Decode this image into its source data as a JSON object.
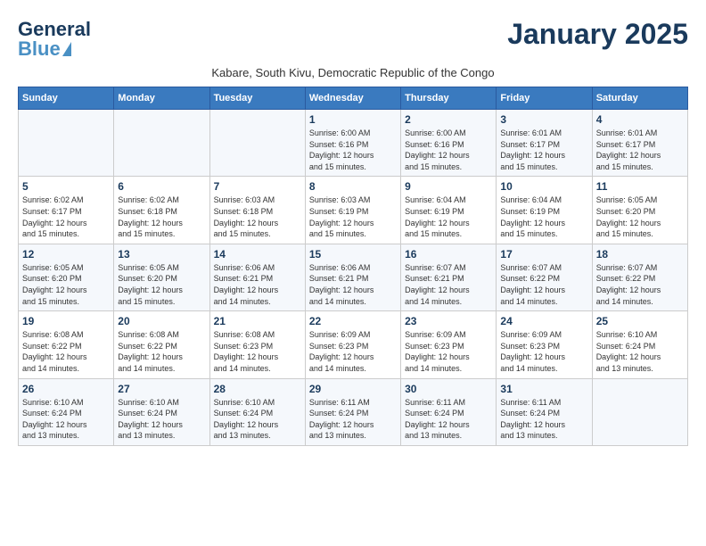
{
  "header": {
    "logo_line1": "General",
    "logo_line2": "Blue",
    "month_title": "January 2025",
    "subtitle": "Kabare, South Kivu, Democratic Republic of the Congo"
  },
  "weekdays": [
    "Sunday",
    "Monday",
    "Tuesday",
    "Wednesday",
    "Thursday",
    "Friday",
    "Saturday"
  ],
  "weeks": [
    [
      {
        "day": "",
        "info": ""
      },
      {
        "day": "",
        "info": ""
      },
      {
        "day": "",
        "info": ""
      },
      {
        "day": "1",
        "info": "Sunrise: 6:00 AM\nSunset: 6:16 PM\nDaylight: 12 hours\nand 15 minutes."
      },
      {
        "day": "2",
        "info": "Sunrise: 6:00 AM\nSunset: 6:16 PM\nDaylight: 12 hours\nand 15 minutes."
      },
      {
        "day": "3",
        "info": "Sunrise: 6:01 AM\nSunset: 6:17 PM\nDaylight: 12 hours\nand 15 minutes."
      },
      {
        "day": "4",
        "info": "Sunrise: 6:01 AM\nSunset: 6:17 PM\nDaylight: 12 hours\nand 15 minutes."
      }
    ],
    [
      {
        "day": "5",
        "info": "Sunrise: 6:02 AM\nSunset: 6:17 PM\nDaylight: 12 hours\nand 15 minutes."
      },
      {
        "day": "6",
        "info": "Sunrise: 6:02 AM\nSunset: 6:18 PM\nDaylight: 12 hours\nand 15 minutes."
      },
      {
        "day": "7",
        "info": "Sunrise: 6:03 AM\nSunset: 6:18 PM\nDaylight: 12 hours\nand 15 minutes."
      },
      {
        "day": "8",
        "info": "Sunrise: 6:03 AM\nSunset: 6:19 PM\nDaylight: 12 hours\nand 15 minutes."
      },
      {
        "day": "9",
        "info": "Sunrise: 6:04 AM\nSunset: 6:19 PM\nDaylight: 12 hours\nand 15 minutes."
      },
      {
        "day": "10",
        "info": "Sunrise: 6:04 AM\nSunset: 6:19 PM\nDaylight: 12 hours\nand 15 minutes."
      },
      {
        "day": "11",
        "info": "Sunrise: 6:05 AM\nSunset: 6:20 PM\nDaylight: 12 hours\nand 15 minutes."
      }
    ],
    [
      {
        "day": "12",
        "info": "Sunrise: 6:05 AM\nSunset: 6:20 PM\nDaylight: 12 hours\nand 15 minutes."
      },
      {
        "day": "13",
        "info": "Sunrise: 6:05 AM\nSunset: 6:20 PM\nDaylight: 12 hours\nand 15 minutes."
      },
      {
        "day": "14",
        "info": "Sunrise: 6:06 AM\nSunset: 6:21 PM\nDaylight: 12 hours\nand 14 minutes."
      },
      {
        "day": "15",
        "info": "Sunrise: 6:06 AM\nSunset: 6:21 PM\nDaylight: 12 hours\nand 14 minutes."
      },
      {
        "day": "16",
        "info": "Sunrise: 6:07 AM\nSunset: 6:21 PM\nDaylight: 12 hours\nand 14 minutes."
      },
      {
        "day": "17",
        "info": "Sunrise: 6:07 AM\nSunset: 6:22 PM\nDaylight: 12 hours\nand 14 minutes."
      },
      {
        "day": "18",
        "info": "Sunrise: 6:07 AM\nSunset: 6:22 PM\nDaylight: 12 hours\nand 14 minutes."
      }
    ],
    [
      {
        "day": "19",
        "info": "Sunrise: 6:08 AM\nSunset: 6:22 PM\nDaylight: 12 hours\nand 14 minutes."
      },
      {
        "day": "20",
        "info": "Sunrise: 6:08 AM\nSunset: 6:22 PM\nDaylight: 12 hours\nand 14 minutes."
      },
      {
        "day": "21",
        "info": "Sunrise: 6:08 AM\nSunset: 6:23 PM\nDaylight: 12 hours\nand 14 minutes."
      },
      {
        "day": "22",
        "info": "Sunrise: 6:09 AM\nSunset: 6:23 PM\nDaylight: 12 hours\nand 14 minutes."
      },
      {
        "day": "23",
        "info": "Sunrise: 6:09 AM\nSunset: 6:23 PM\nDaylight: 12 hours\nand 14 minutes."
      },
      {
        "day": "24",
        "info": "Sunrise: 6:09 AM\nSunset: 6:23 PM\nDaylight: 12 hours\nand 14 minutes."
      },
      {
        "day": "25",
        "info": "Sunrise: 6:10 AM\nSunset: 6:24 PM\nDaylight: 12 hours\nand 13 minutes."
      }
    ],
    [
      {
        "day": "26",
        "info": "Sunrise: 6:10 AM\nSunset: 6:24 PM\nDaylight: 12 hours\nand 13 minutes."
      },
      {
        "day": "27",
        "info": "Sunrise: 6:10 AM\nSunset: 6:24 PM\nDaylight: 12 hours\nand 13 minutes."
      },
      {
        "day": "28",
        "info": "Sunrise: 6:10 AM\nSunset: 6:24 PM\nDaylight: 12 hours\nand 13 minutes."
      },
      {
        "day": "29",
        "info": "Sunrise: 6:11 AM\nSunset: 6:24 PM\nDaylight: 12 hours\nand 13 minutes."
      },
      {
        "day": "30",
        "info": "Sunrise: 6:11 AM\nSunset: 6:24 PM\nDaylight: 12 hours\nand 13 minutes."
      },
      {
        "day": "31",
        "info": "Sunrise: 6:11 AM\nSunset: 6:24 PM\nDaylight: 12 hours\nand 13 minutes."
      },
      {
        "day": "",
        "info": ""
      }
    ]
  ]
}
